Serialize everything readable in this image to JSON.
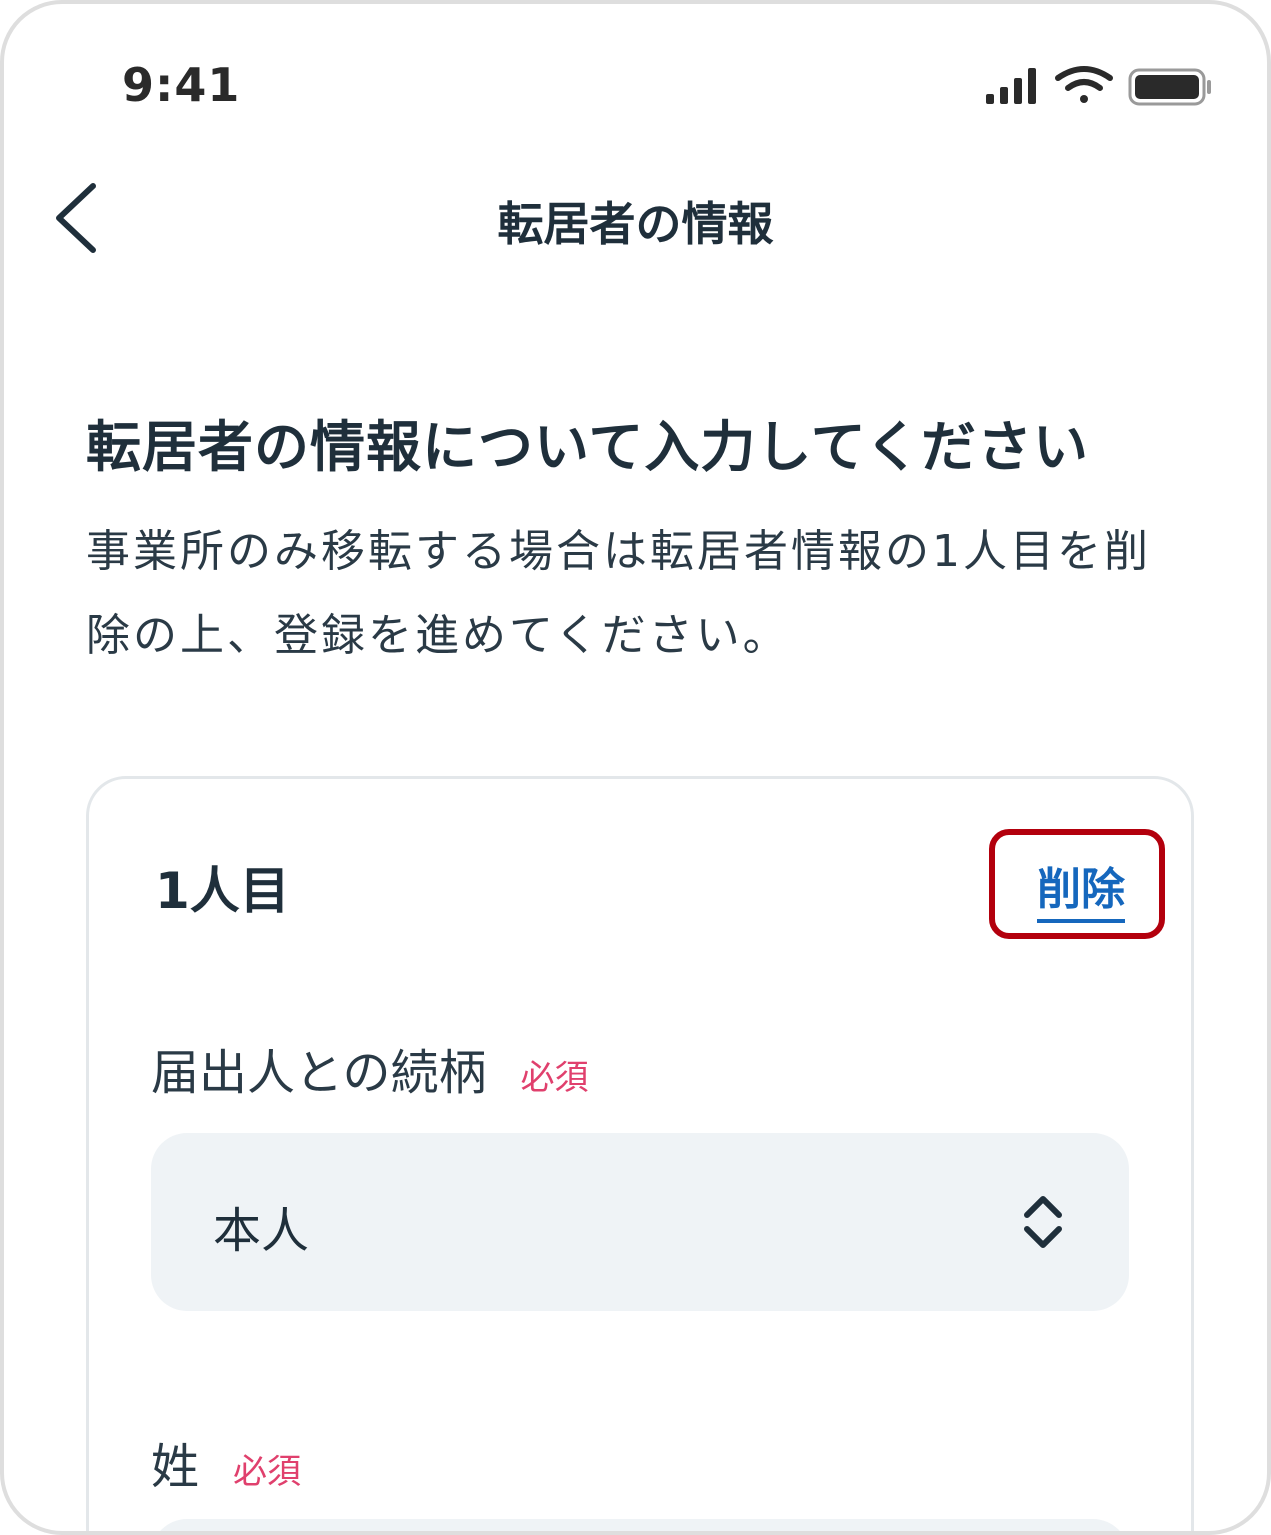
{
  "status_bar": {
    "time": "9:41",
    "icons": [
      "signal-icon",
      "wifi-icon",
      "battery-icon"
    ]
  },
  "nav": {
    "back_icon": "chevron-left-icon",
    "title": "転居者の情報"
  },
  "content": {
    "heading": "転居者の情報について入力してください",
    "description": "事業所のみ移転する場合は転居者情報の1人目を削除の上、登録を進めてください。"
  },
  "person_card": {
    "label": "1人目",
    "delete_label": "削除",
    "relation_field": {
      "label": "届出人との続柄",
      "required": "必須",
      "selected_value": "本人",
      "icon": "chevron-up-down-icon"
    },
    "surname_field": {
      "label": "姓",
      "required": "必須"
    }
  },
  "colors": {
    "text_primary": "#1f2f3b",
    "link_blue": "#1567bd",
    "required_pink": "#e0406d",
    "highlight_red": "#b3000d",
    "input_bg": "#eff3f6"
  }
}
